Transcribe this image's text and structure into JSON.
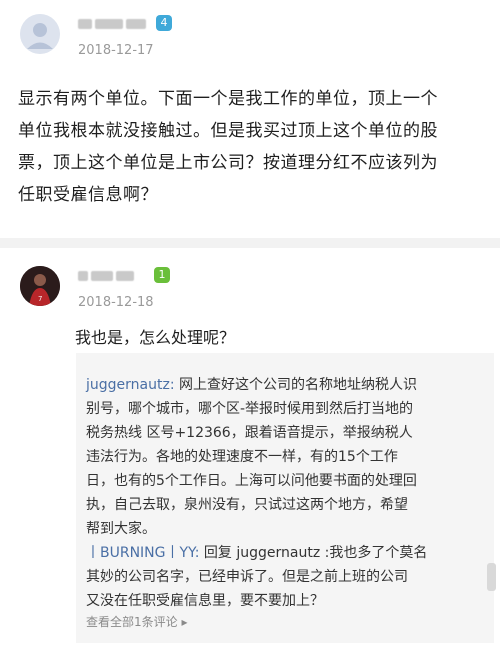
{
  "colors": {
    "badge_level4": "#3fa9d9",
    "badge_level1": "#6abf3a",
    "link_blue": "#4a6fa5"
  },
  "comment1": {
    "avatar": "default-avatar-icon",
    "badge": "4",
    "date": "2018-12-17",
    "text_lines": [
      "显示有两个单位。下面一个是我工作的单位，顶上一个",
      "单位我根本就没接触过。但是我买过顶上这个单位的股",
      "票，顶上这个单位是上市公司？按道理分红不应该列为",
      "任职受雇信息啊？"
    ]
  },
  "comment2": {
    "avatar": "user-avatar-icon",
    "badge": "1",
    "date": "2018-12-18",
    "text": "我也是，怎么处理呢？",
    "replies": {
      "r1_user": "juggernautz:",
      "r1_lines": [
        " 网上查好这个公司的名称地址纳税人识",
        "别号，哪个城市，哪个区-举报时候用到然后打当地的",
        "税务热线 区号+12366，跟着语音提示，举报纳税人",
        "违法行为。各地的处理速度不一样，有的15个工作",
        "日，也有的5个工作日。上海可以问他要书面的处理回",
        "执，自己去取，泉州没有，只试过这两个地方，希望",
        "帮到大家。"
      ],
      "r2_user": "丨BURNING丨YY:",
      "r2_first": " 回复 juggernautz :我也多了个莫名",
      "r2_lines": [
        "其妙的公司名字，已经申诉了。但是之前上班的公司",
        "又没在任职受雇信息里，要不要加上？"
      ],
      "view_all": "查看全部1条评论 ▸"
    }
  }
}
